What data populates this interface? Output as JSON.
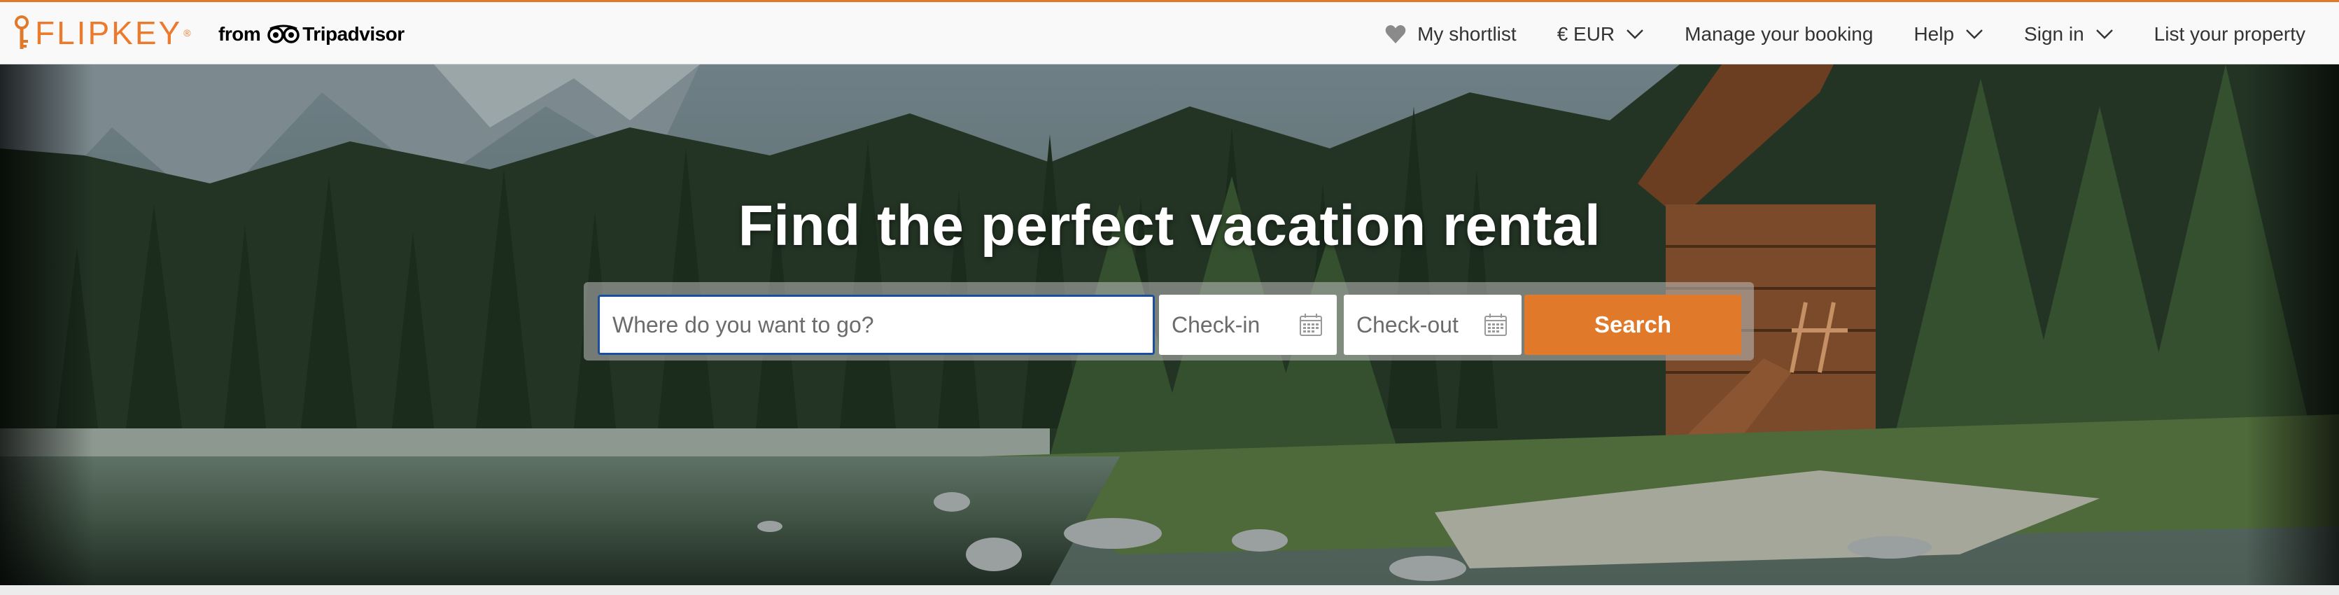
{
  "brand": {
    "logo_text": "FLIPKEY",
    "from_text": "from",
    "partner_text": "Tripadvisor",
    "accent_color": "#e07a2a"
  },
  "nav": {
    "shortlist": "My shortlist",
    "currency": "€ EUR",
    "manage_booking": "Manage your booking",
    "help": "Help",
    "sign_in": "Sign in",
    "list_property": "List your property"
  },
  "hero": {
    "title": "Find the perfect vacation rental"
  },
  "search": {
    "destination_placeholder": "Where do you want to go?",
    "checkin_label": "Check-in",
    "checkout_label": "Check-out",
    "button_label": "Search",
    "button_color": "#e07a2a"
  },
  "icons": {
    "shortlist": "heart-icon",
    "dropdown": "chevron-down-icon",
    "date": "calendar-icon",
    "partner": "tripadvisor-owl-icon",
    "logo": "key-icon"
  }
}
